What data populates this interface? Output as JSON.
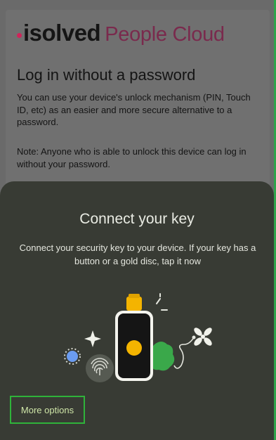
{
  "brand": {
    "logo_isolved": "isolved",
    "logo_people_cloud": "People Cloud"
  },
  "login": {
    "title": "Log in without a password",
    "description": "You can use your device's unlock mechanism (PIN, Touch ID, etc) as an easier and more secure alternative to a password.",
    "note": "Note: Anyone who is able to unlock this device can log in without your password."
  },
  "sheet": {
    "title": "Connect your key",
    "description": "Connect your security key to your device. If your key has a button or a gold disc, tap it now",
    "more_options_label": "More options"
  },
  "colors": {
    "sheet_bg": "#383b34",
    "accent_green": "#2fb33a",
    "brand_pink": "#d0245a",
    "key_gold": "#f4b400",
    "blob_green": "#3aa84a",
    "dot_blue": "#6b9cf0"
  }
}
